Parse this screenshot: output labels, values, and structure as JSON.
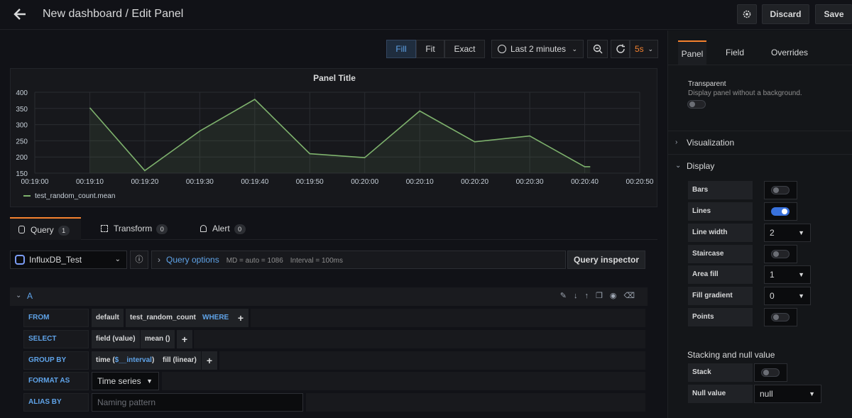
{
  "header": {
    "title": "New dashboard / Edit Panel",
    "discard_label": "Discard",
    "save_label": "Save"
  },
  "view_modes": [
    "Fill",
    "Fit",
    "Exact"
  ],
  "time_picker": {
    "label": "Last 2 minutes"
  },
  "refresh": {
    "interval": "5s"
  },
  "panel": {
    "title": "Panel Title",
    "legend": "test_random_count.mean"
  },
  "chart_data": {
    "type": "area",
    "title": "Panel Title",
    "x": [
      "00:19:10",
      "00:19:20",
      "00:19:30",
      "00:19:40",
      "00:19:50",
      "00:20:00",
      "00:20:10",
      "00:20:20",
      "00:20:30",
      "00:20:40",
      "00:20:41"
    ],
    "series": [
      {
        "name": "test_random_count.mean",
        "color": "#7eb26d",
        "values": [
          352,
          158,
          280,
          378,
          210,
          198,
          342,
          247,
          265,
          170,
          170
        ]
      }
    ],
    "xticks": [
      "00:19:00",
      "00:19:10",
      "00:19:20",
      "00:19:30",
      "00:19:40",
      "00:19:50",
      "00:20:00",
      "00:20:10",
      "00:20:20",
      "00:20:30",
      "00:20:40",
      "00:20:50"
    ],
    "yticks": [
      150,
      200,
      250,
      300,
      350,
      400
    ],
    "ylim": [
      150,
      400
    ],
    "grid": true,
    "legend": "bottom-left"
  },
  "query_tabs": [
    {
      "label": "Query",
      "count": "1"
    },
    {
      "label": "Transform",
      "count": "0"
    },
    {
      "label": "Alert",
      "count": "0"
    }
  ],
  "datasource": {
    "name": "InfluxDB_Test"
  },
  "query_options": {
    "label": "Query options",
    "md": "MD = auto = 1086",
    "interval": "Interval = 100ms",
    "inspector_label": "Query inspector"
  },
  "query": {
    "letter": "A",
    "from_label": "FROM",
    "from_policy": "default",
    "from_measurement": "test_random_count",
    "where_label": "WHERE",
    "select_label": "SELECT",
    "select_field": "field (value)",
    "select_fn": "mean ()",
    "group_label": "GROUP BY",
    "group_time_prefix": "time (",
    "group_time_var": "$__interval",
    "group_time_suffix": ")",
    "group_fill": "fill (linear)",
    "format_label": "FORMAT AS",
    "format_value": "Time series",
    "alias_label": "ALIAS BY",
    "alias_placeholder": "Naming pattern",
    "plus": "+"
  },
  "side": {
    "tabs": [
      "Panel",
      "Field",
      "Overrides"
    ],
    "transparent_label": "Transparent",
    "transparent_desc": "Display panel without a background.",
    "visualization": "Visualization",
    "display": "Display",
    "bars": "Bars",
    "lines": "Lines",
    "line_width": "Line width",
    "line_width_value": "2",
    "staircase": "Staircase",
    "area_fill": "Area fill",
    "area_fill_value": "1",
    "fill_gradient": "Fill gradient",
    "fill_gradient_value": "0",
    "points": "Points",
    "stacking_title": "Stacking and null value",
    "stack": "Stack",
    "null_value": "Null value",
    "null_value_value": "null"
  }
}
